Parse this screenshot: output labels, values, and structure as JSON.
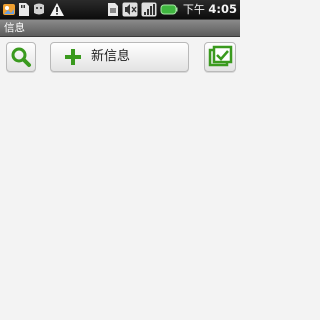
{
  "status_bar": {
    "icons": [
      "picture-icon",
      "sd-card-icon",
      "usb-debug-icon",
      "warning-icon",
      "sim-card-icon",
      "mute-icon",
      "signal-icon",
      "battery-icon"
    ],
    "period": "下午",
    "time": "4:05",
    "battery_color": "#3fb63f"
  },
  "title_bar": {
    "title": "信息"
  },
  "toolbar": {
    "search_icon": "search-icon",
    "new_message_label": "新信息",
    "new_message_icon": "plus-icon",
    "compose_icon": "compose-icon",
    "accent_color": "#3a9a1e"
  }
}
